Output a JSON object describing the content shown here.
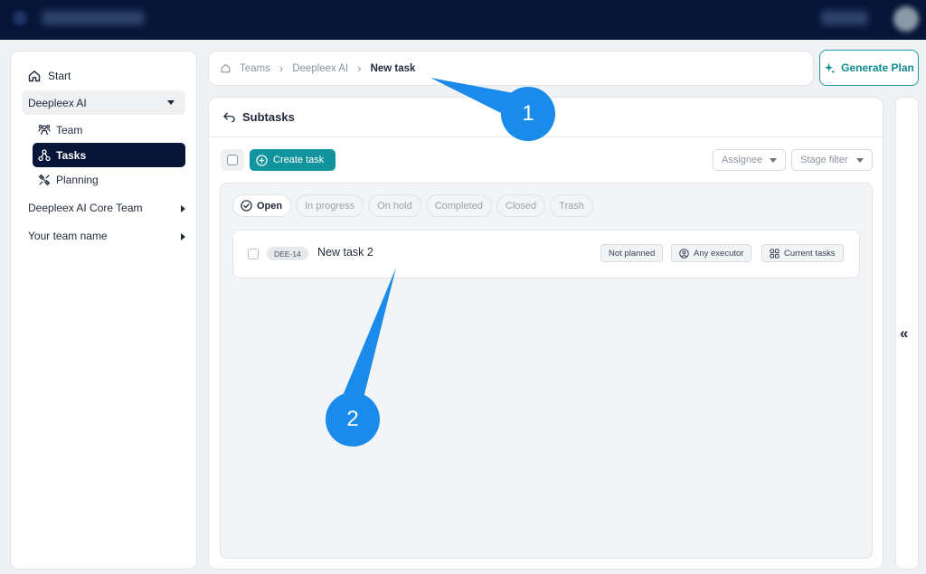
{
  "sidebar": {
    "start": "Start",
    "group": "Deepleex AI",
    "team": "Team",
    "tasks": "Tasks",
    "planning": "Planning",
    "core_team": "Deepleex AI Core Team",
    "your_team": "Your team name"
  },
  "breadcrumb": {
    "items": [
      "Teams",
      "Deepleex AI"
    ],
    "current": "New task"
  },
  "generate_plan": "Generate Plan",
  "main": {
    "title": "Subtasks",
    "create_task": "Create task",
    "filters": {
      "assignee": "Assignee",
      "stage": "Stage filter"
    },
    "tabs": [
      "Open",
      "In progress",
      "On hold",
      "Completed",
      "Closed",
      "Trash"
    ],
    "active_tab": "Open",
    "tasks": [
      {
        "key": "DEE-14",
        "title": "New task 2",
        "plan": "Not planned",
        "executor": "Any executor",
        "scope": "Current tasks"
      }
    ]
  },
  "right_rail": {
    "collapse_glyph": "«"
  },
  "callouts": [
    "1",
    "2"
  ],
  "colors": {
    "topbar": "#061538",
    "accent": "#11949d",
    "callout": "#1a8bea",
    "active_nav": "#061538"
  }
}
